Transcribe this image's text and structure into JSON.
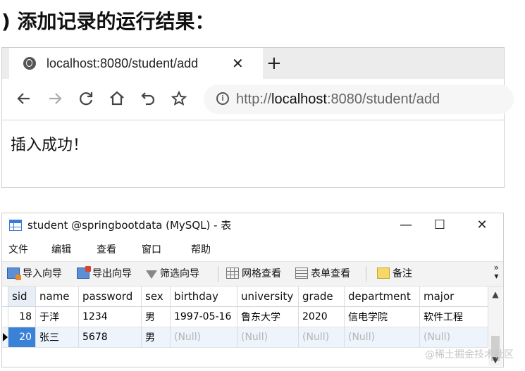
{
  "heading": ") 添加记录的运行结果：",
  "browser": {
    "tab_title": "localhost:8080/student/add",
    "tab_close": "✕",
    "new_tab": "+",
    "url_scheme": "http://",
    "url_host": "localhost",
    "url_rest": ":8080/student/add",
    "page_text": "插入成功！"
  },
  "navicat": {
    "title": "student @springbootdata (MySQL) - 表",
    "window_buttons": {
      "minimize": "—",
      "maximize": "☐",
      "close": "✕"
    },
    "menu": [
      "文件",
      "编辑",
      "查看",
      "窗口",
      "帮助"
    ],
    "toolbar": [
      "导入向导",
      "导出向导",
      "筛选向导",
      "网格查看",
      "表单查看",
      "备注"
    ],
    "toolbar_more": "»",
    "columns": [
      "sid",
      "name",
      "password",
      "sex",
      "birthday",
      "university",
      "grade",
      "department",
      "major"
    ],
    "rows": [
      [
        "18",
        "于洋",
        "1234",
        "男",
        "1997-05-16",
        "鲁东大学",
        "2020",
        "信电学院",
        "软件工程"
      ],
      [
        "20",
        "张三",
        "5678",
        "男",
        "(Null)",
        "(Null)",
        "(Null)",
        "(Null)",
        "(Null)"
      ]
    ]
  },
  "watermark": "@稀土掘金技术社区",
  "colors": {
    "selection": "#3a82d8",
    "row_highlight": "#eef4fc",
    "null_text": "#b4b4b4"
  }
}
